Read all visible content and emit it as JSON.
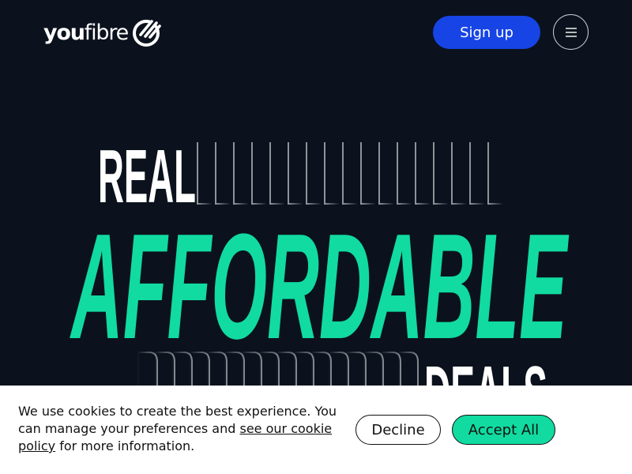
{
  "brand": {
    "name_bold": "you",
    "name_light": "fibre",
    "logo_icon": "youfibre-mark-icon"
  },
  "header": {
    "signup_label": "Sign up",
    "menu_icon": "hamburger-menu-icon"
  },
  "hero": {
    "line1": "REAL",
    "line2": "AFFORDABLE",
    "line3": "DEALS"
  },
  "colors": {
    "background": "#0b121d",
    "accent_green": "#11dba0",
    "accent_blue": "#1744e4",
    "text_white": "#ffffff"
  },
  "cookie": {
    "text_before": "We use cookies to create the best experience. You can manage your preferences and ",
    "link_label": "see our cookie policy",
    "text_after": " for more information.",
    "decline_label": "Decline",
    "accept_label": "Accept All"
  }
}
